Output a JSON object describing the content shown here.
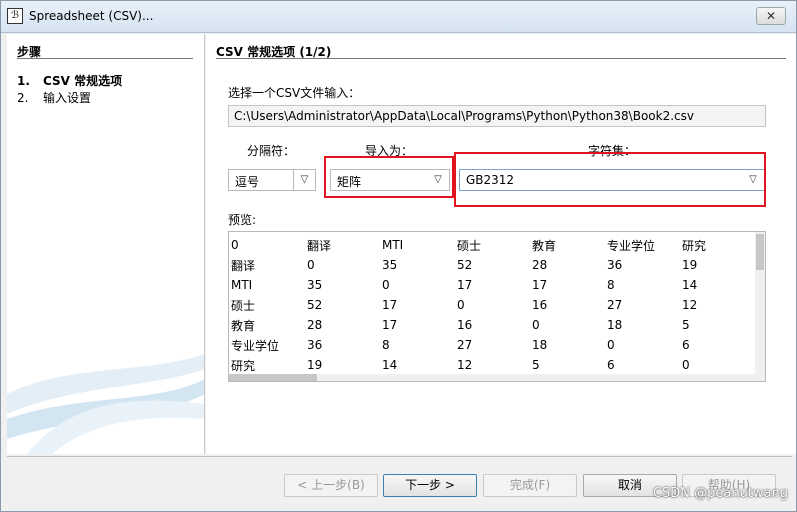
{
  "window": {
    "title": "Spreadsheet (CSV)...",
    "close_symbol": "✕"
  },
  "steps": {
    "heading": "步骤",
    "items": [
      {
        "num": "1.",
        "label": "CSV 常规选项"
      },
      {
        "num": "2.",
        "label": "输入设置"
      }
    ]
  },
  "section": {
    "title": "CSV 常规选项 (1/2)",
    "file_label": "选择一个CSV文件输入：",
    "file_path": "C:\\Users\\Administrator\\AppData\\Local\\Programs\\Python\\Python38\\Book2.csv"
  },
  "options": {
    "separator_label": "分隔符：",
    "separator_value": "逗号",
    "import_label": "导入为：",
    "import_value": "矩阵",
    "charset_label": "字符集：",
    "charset_value": "GB2312"
  },
  "preview": {
    "label": "预览:",
    "rows": [
      [
        "0",
        "翻译",
        "MTI",
        "硕士",
        "教育",
        "专业学位",
        "研究"
      ],
      [
        "翻译",
        "0",
        "35",
        "52",
        "28",
        "36",
        "19"
      ],
      [
        "MTI",
        "35",
        "0",
        "17",
        "17",
        "8",
        "14"
      ],
      [
        "硕士",
        "52",
        "17",
        "0",
        "16",
        "27",
        "12"
      ],
      [
        "教育",
        "28",
        "17",
        "16",
        "0",
        "18",
        "5"
      ],
      [
        "专业学位",
        "36",
        "8",
        "27",
        "18",
        "0",
        "6"
      ],
      [
        "研究",
        "19",
        "14",
        "12",
        "5",
        "6",
        "0"
      ]
    ]
  },
  "buttons": {
    "prev": "< 上一步(B)",
    "next": "下一步 >",
    "finish": "完成(F)",
    "cancel": "取消",
    "help": "帮助(H)"
  },
  "watermark": "CSDN @peanutwang",
  "colors": {
    "highlight": "#e0141e",
    "accent_border": "#3c7fb1"
  }
}
